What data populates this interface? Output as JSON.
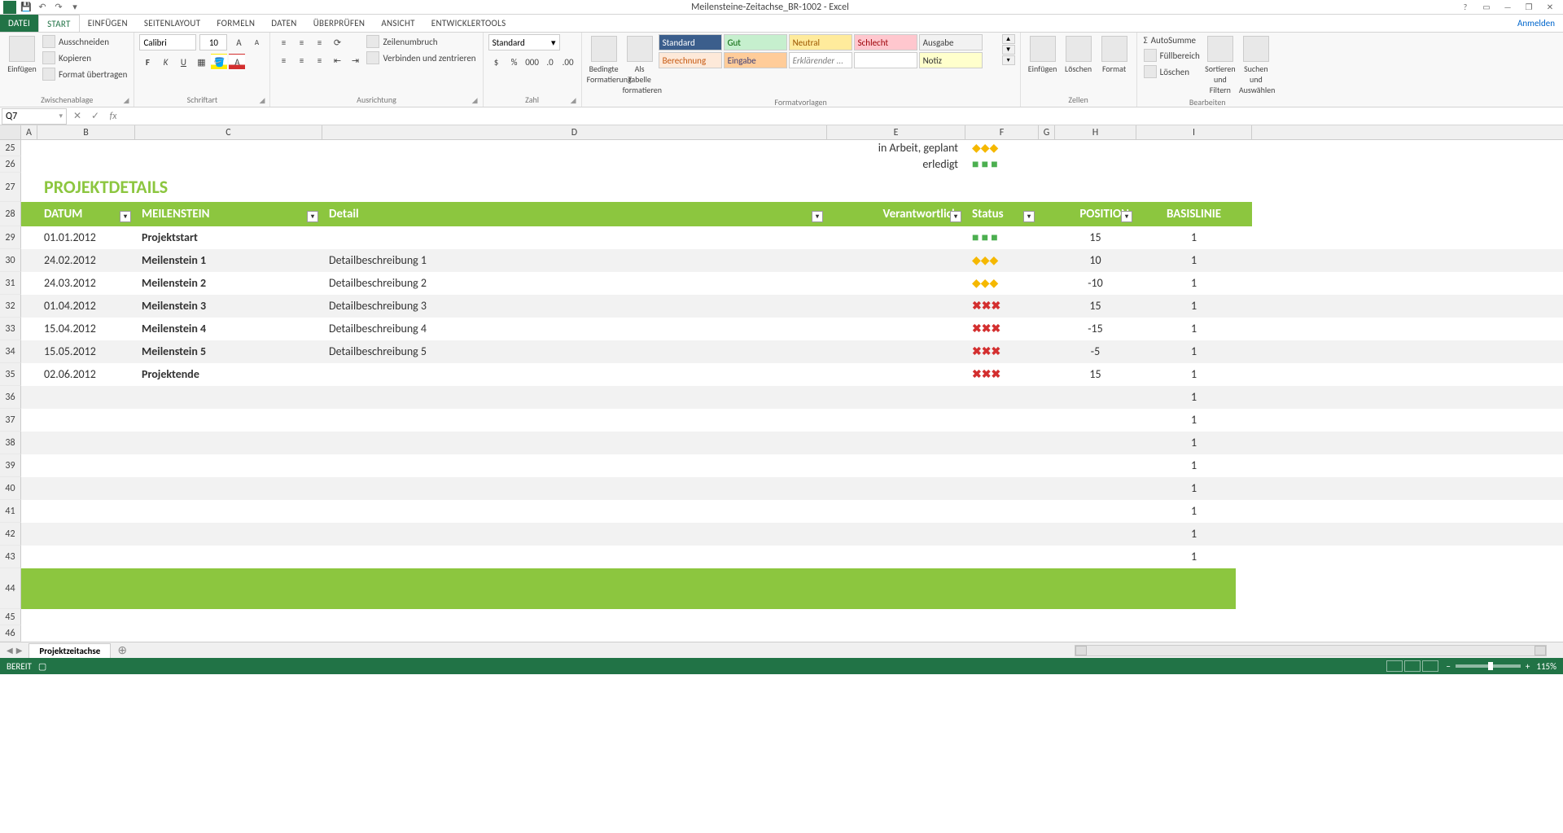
{
  "app": {
    "title": "Meilensteine-Zeitachse_BR-1002 - Excel",
    "login": "Anmelden"
  },
  "menu": {
    "file": "DATEI",
    "tabs": [
      "START",
      "EINFÜGEN",
      "SEITENLAYOUT",
      "FORMELN",
      "DATEN",
      "ÜBERPRÜFEN",
      "ANSICHT",
      "ENTWICKLERTOOLS"
    ],
    "active": 0
  },
  "ribbon": {
    "clipboard": {
      "label": "Zwischenablage",
      "paste": "Einfügen",
      "cut": "Ausschneiden",
      "copy": "Kopieren",
      "format_painter": "Format übertragen"
    },
    "font": {
      "label": "Schriftart",
      "name": "Calibri",
      "size": "10"
    },
    "alignment": {
      "label": "Ausrichtung",
      "wrap": "Zeilenumbruch",
      "merge": "Verbinden und zentrieren"
    },
    "number": {
      "label": "Zahl",
      "format": "Standard"
    },
    "styles": {
      "label": "Formatvorlagen",
      "cond": "Bedingte Formatierung",
      "table": "Als Tabelle formatieren",
      "items": [
        {
          "name": "Standard",
          "bg": "#3b5e8c",
          "fg": "#fff"
        },
        {
          "name": "Gut",
          "bg": "#c6efce",
          "fg": "#006100"
        },
        {
          "name": "Neutral",
          "bg": "#ffeb9c",
          "fg": "#9c5700"
        },
        {
          "name": "Schlecht",
          "bg": "#ffc7ce",
          "fg": "#9c0006"
        },
        {
          "name": "Ausgabe",
          "bg": "#f2f2f2",
          "fg": "#3f3f3f"
        },
        {
          "name": "Berechnung",
          "bg": "#fde9d9",
          "fg": "#c65911"
        },
        {
          "name": "Eingabe",
          "bg": "#ffcc99",
          "fg": "#3f3f76"
        },
        {
          "name": "Erklärender ...",
          "bg": "#fff",
          "fg": "#7f7f7f",
          "italic": true
        },
        {
          "name": "",
          "bg": "#fff",
          "fg": "#9c0006"
        },
        {
          "name": "Notiz",
          "bg": "#ffffcc",
          "fg": "#333"
        }
      ]
    },
    "cells": {
      "label": "Zellen",
      "insert": "Einfügen",
      "delete": "Löschen",
      "format": "Format"
    },
    "editing": {
      "label": "Bearbeiten",
      "autosum": "AutoSumme",
      "fill": "Füllbereich",
      "clear": "Löschen",
      "sort": "Sortieren und Filtern",
      "find": "Suchen und Auswählen"
    }
  },
  "fxbar": {
    "name": "Q7",
    "formula": ""
  },
  "columns": [
    "A",
    "B",
    "C",
    "D",
    "E",
    "F",
    "G",
    "H",
    "I"
  ],
  "legend": {
    "in_progress": "in Arbeit, geplant",
    "done": "erledigt"
  },
  "section_title": "PROJEKTDETAILS",
  "headers": {
    "datum": "DATUM",
    "meilenstein": "MEILENSTEIN",
    "detail": "Detail",
    "verantwortlich": "Verantwortlich",
    "status": "Status",
    "position": "POSITION",
    "basislinie": "BASISLINIE"
  },
  "rows": [
    {
      "r": 29,
      "datum": "01.01.2012",
      "meilenstein": "Projektstart",
      "detail": "",
      "status": "done",
      "position": "15",
      "basis": "1"
    },
    {
      "r": 30,
      "datum": "24.02.2012",
      "meilenstein": "Meilenstein 1",
      "detail": "Detailbeschreibung 1",
      "status": "prog",
      "position": "10",
      "basis": "1"
    },
    {
      "r": 31,
      "datum": "24.03.2012",
      "meilenstein": "Meilenstein 2",
      "detail": "Detailbeschreibung 2",
      "status": "prog",
      "position": "-10",
      "basis": "1"
    },
    {
      "r": 32,
      "datum": "01.04.2012",
      "meilenstein": "Meilenstein 3",
      "detail": "Detailbeschreibung 3",
      "status": "not",
      "position": "15",
      "basis": "1"
    },
    {
      "r": 33,
      "datum": "15.04.2012",
      "meilenstein": "Meilenstein 4",
      "detail": "Detailbeschreibung 4",
      "status": "not",
      "position": "-15",
      "basis": "1"
    },
    {
      "r": 34,
      "datum": "15.05.2012",
      "meilenstein": "Meilenstein 5",
      "detail": "Detailbeschreibung 5",
      "status": "not",
      "position": "-5",
      "basis": "1"
    },
    {
      "r": 35,
      "datum": "02.06.2012",
      "meilenstein": "Projektende",
      "detail": "",
      "status": "not",
      "position": "15",
      "basis": "1"
    }
  ],
  "empty_rows": [
    {
      "r": 36,
      "basis": "1"
    },
    {
      "r": 37,
      "basis": "1"
    },
    {
      "r": 38,
      "basis": "1"
    },
    {
      "r": 39,
      "basis": "1"
    },
    {
      "r": 40,
      "basis": "1"
    },
    {
      "r": 41,
      "basis": "1"
    },
    {
      "r": 42,
      "basis": "1"
    },
    {
      "r": 43,
      "basis": "1"
    }
  ],
  "post_rows": [
    45,
    46
  ],
  "sheet": {
    "name": "Projektzeitachse"
  },
  "statusbar": {
    "ready": "BEREIT",
    "zoom": "115%"
  }
}
